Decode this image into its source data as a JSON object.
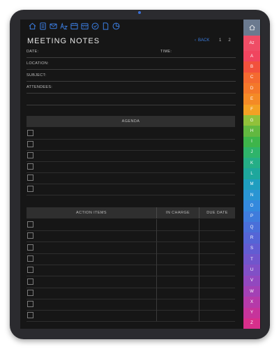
{
  "page": {
    "title": "MEETING NOTES",
    "back_label": "BACK",
    "page_numbers": [
      "1",
      "2"
    ]
  },
  "toolbar_icons": [
    "home-icon",
    "notes-icon",
    "mail-icon",
    "az-icon",
    "planner-icon",
    "calendar-icon",
    "check-icon",
    "document-icon",
    "pie-chart-icon"
  ],
  "fields": {
    "date": "DATE:",
    "time": "TIME:",
    "location": "LOCATION:",
    "subject": "SUBJECT:",
    "attendees": "ATTENDEES:"
  },
  "agenda": {
    "header": "AGENDA",
    "row_count": 6
  },
  "action_items": {
    "headers": [
      "ACTION ITEMS",
      "IN CHARGE",
      "DUE DATE"
    ],
    "row_count": 9
  },
  "tabs": {
    "home_icon": "home-icon",
    "az_label": "Az",
    "letters": [
      "A",
      "B",
      "C",
      "D",
      "E",
      "F",
      "G",
      "H",
      "I",
      "J",
      "K",
      "L",
      "M",
      "N",
      "O",
      "P",
      "Q",
      "R",
      "S",
      "T",
      "U",
      "V",
      "W",
      "X",
      "Y",
      "Z"
    ],
    "colors": {
      "A": "#f0455f",
      "B": "#f2513c",
      "C": "#f46a30",
      "D": "#f4782a",
      "E": "#f48a26",
      "F": "#f3a124",
      "G": "#91c13a",
      "H": "#62b840",
      "I": "#3eb54a",
      "J": "#2fb46a",
      "K": "#25ae86",
      "L": "#1ea79c",
      "M": "#1f9ebf",
      "N": "#2a95d3",
      "O": "#3489dd",
      "P": "#3f7cdc",
      "Q": "#4a6fd9",
      "R": "#5565d6",
      "S": "#625dd2",
      "T": "#7156cc",
      "U": "#8150c6",
      "V": "#9248bf",
      "W": "#a341b5",
      "X": "#b53aa9",
      "Y": "#c6349b",
      "Z": "#d72f8b"
    }
  },
  "colors": {
    "background": "#161616",
    "accent": "#3b7de0",
    "header_bar": "#2f2f2f"
  }
}
